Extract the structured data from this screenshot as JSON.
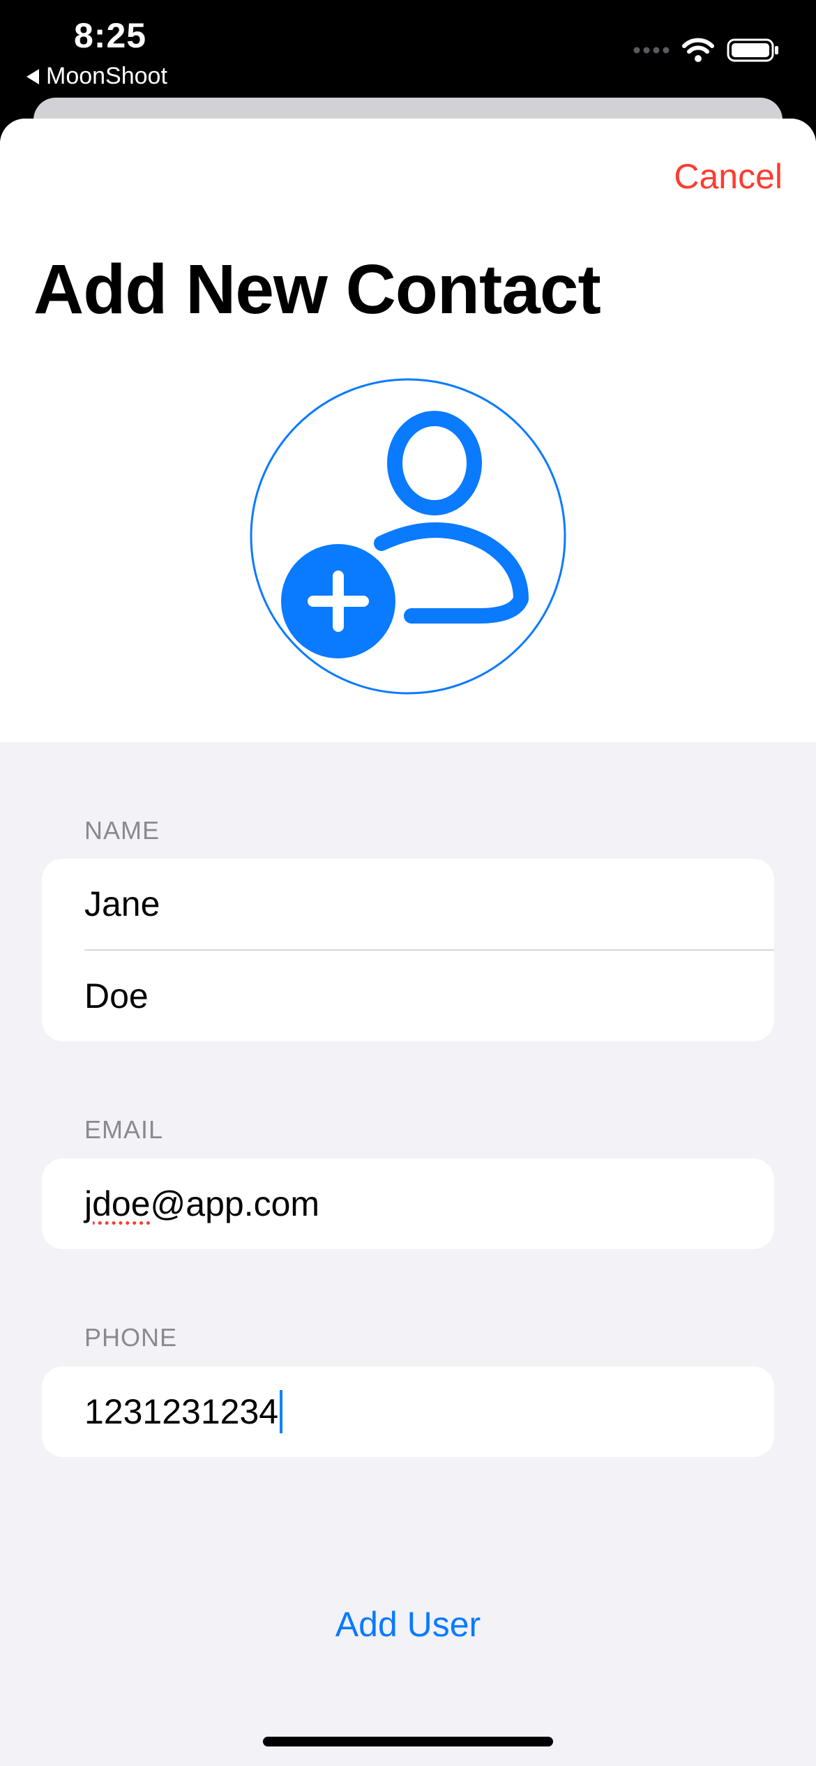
{
  "status_bar": {
    "time": "8:25",
    "back_app": "MoonShoot",
    "icons": [
      "cellular-icon",
      "wifi-icon",
      "battery-icon"
    ]
  },
  "sheet": {
    "cancel_label": "Cancel",
    "title": "Add New Contact",
    "avatar_icon": "person-badge-plus-icon"
  },
  "form": {
    "name": {
      "label": "NAME",
      "first": "Jane",
      "last": "Doe"
    },
    "email": {
      "label": "EMAIL",
      "value": "jdoe@app.com",
      "misspelled_part": "jdoe",
      "rest": "@app.com"
    },
    "phone": {
      "label": "PHONE",
      "value": "1231231234"
    }
  },
  "actions": {
    "add_user_label": "Add User"
  },
  "colors": {
    "accent": "#0a7aff",
    "destructive": "#ff3b30",
    "grouped_background": "#f2f2f7",
    "secondary_label": "#8a8a8e"
  }
}
